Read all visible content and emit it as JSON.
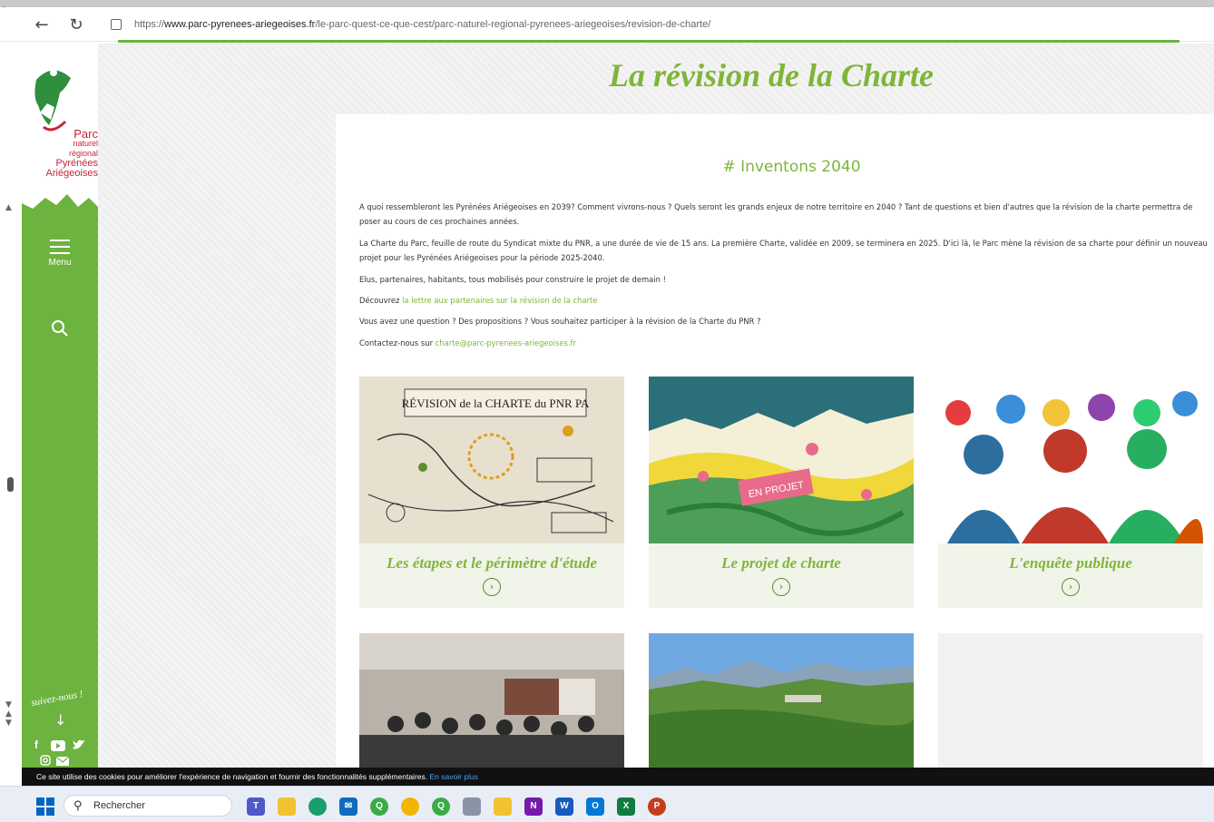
{
  "browser": {
    "url_prefix": "https://",
    "url_domain": "www.parc-pyrenees-ariegeoises.fr",
    "url_path": "/le-parc-quest-ce-que-cest/parc-naturel-regional-pyrenees-ariegeoises/revision-de-charte/"
  },
  "logo": {
    "line1": "Parc",
    "line2": "naturel",
    "line3": "régional",
    "line4": "Pyrénées",
    "line5": "Ariégeoises"
  },
  "sidebar": {
    "menu_label": "Menu",
    "follow_label": "suivez-nous !"
  },
  "page": {
    "title": "La révision de la Charte",
    "subheading": "# Inventons 2040",
    "p1": "A quoi ressembleront les Pyrénées Ariégeoises en 2039? Comment vivrons-nous ? Quels seront les grands enjeux de notre territoire en 2040 ? Tant de questions et bien d'autres que la révision de la charte permettra de poser au cours de ces prochaines années.",
    "p2": "La Charte du Parc, feuille de route du Syndicat mixte du PNR, a une durée de vie de 15 ans. La première Charte, validée en 2009, se terminera en 2025. D'ici là, le Parc mène la révision de sa charte pour définir un nouveau projet pour les Pyrénées Ariégeoises pour la période 2025-2040.",
    "p3": "Elus, partenaires, habitants, tous mobilisés pour construire le projet de demain !",
    "p4_prefix": "Découvrez ",
    "p4_link": "la lettre aux partenaires sur la révision de la charte",
    "p5": "Vous avez une question ? Des propositions ? Vous souhaitez participer à la révision de la Charte du PNR ?",
    "p6_prefix": "Contactez-nous sur ",
    "p6_link": "charte@parc-pyrenees-ariegeoises.fr"
  },
  "cards": [
    {
      "title": "Les étapes et le périmètre d'étude",
      "image_text": "RÉVISION de la CHARTE du PNR PA"
    },
    {
      "title": "Le projet de charte",
      "image_text": "EN PROJET"
    },
    {
      "title": "L'enquête publique"
    }
  ],
  "cookie": {
    "text": "Ce site utilise des cookies pour améliorer l'expérience de navigation et fournir des fonctionnalités supplémentaires.",
    "link": "En savoir plus"
  },
  "taskbar": {
    "search_placeholder": "Rechercher"
  },
  "colors": {
    "brand_green": "#6db33f",
    "title_green": "#7fb53a",
    "brand_red": "#c6263a"
  }
}
